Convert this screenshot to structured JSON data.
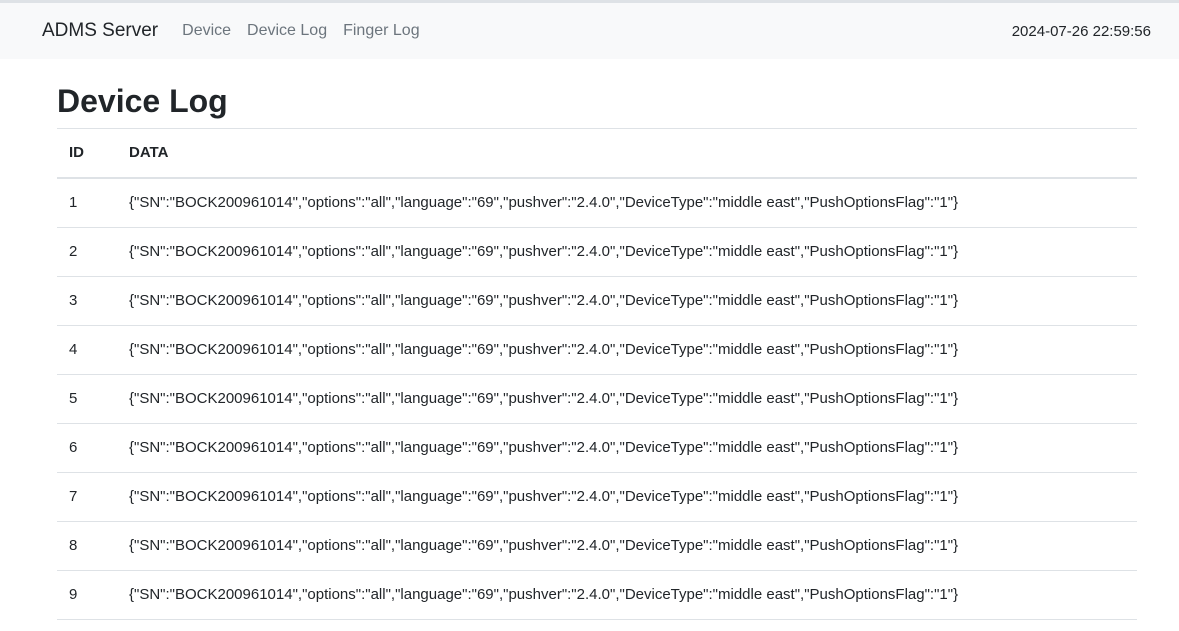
{
  "navbar": {
    "brand": "ADMS Server",
    "links": [
      "Device",
      "Device Log",
      "Finger Log"
    ],
    "clock": "2024-07-26 22:59:56"
  },
  "page": {
    "title": "Device Log"
  },
  "table": {
    "headers": [
      "ID",
      "DATA"
    ],
    "rows": [
      {
        "id": "1",
        "data": "{\"SN\":\"BOCK200961014\",\"options\":\"all\",\"language\":\"69\",\"pushver\":\"2.4.0\",\"DeviceType\":\"middle east\",\"PushOptionsFlag\":\"1\"}"
      },
      {
        "id": "2",
        "data": "{\"SN\":\"BOCK200961014\",\"options\":\"all\",\"language\":\"69\",\"pushver\":\"2.4.0\",\"DeviceType\":\"middle east\",\"PushOptionsFlag\":\"1\"}"
      },
      {
        "id": "3",
        "data": "{\"SN\":\"BOCK200961014\",\"options\":\"all\",\"language\":\"69\",\"pushver\":\"2.4.0\",\"DeviceType\":\"middle east\",\"PushOptionsFlag\":\"1\"}"
      },
      {
        "id": "4",
        "data": "{\"SN\":\"BOCK200961014\",\"options\":\"all\",\"language\":\"69\",\"pushver\":\"2.4.0\",\"DeviceType\":\"middle east\",\"PushOptionsFlag\":\"1\"}"
      },
      {
        "id": "5",
        "data": "{\"SN\":\"BOCK200961014\",\"options\":\"all\",\"language\":\"69\",\"pushver\":\"2.4.0\",\"DeviceType\":\"middle east\",\"PushOptionsFlag\":\"1\"}"
      },
      {
        "id": "6",
        "data": "{\"SN\":\"BOCK200961014\",\"options\":\"all\",\"language\":\"69\",\"pushver\":\"2.4.0\",\"DeviceType\":\"middle east\",\"PushOptionsFlag\":\"1\"}"
      },
      {
        "id": "7",
        "data": "{\"SN\":\"BOCK200961014\",\"options\":\"all\",\"language\":\"69\",\"pushver\":\"2.4.0\",\"DeviceType\":\"middle east\",\"PushOptionsFlag\":\"1\"}"
      },
      {
        "id": "8",
        "data": "{\"SN\":\"BOCK200961014\",\"options\":\"all\",\"language\":\"69\",\"pushver\":\"2.4.0\",\"DeviceType\":\"middle east\",\"PushOptionsFlag\":\"1\"}"
      },
      {
        "id": "9",
        "data": "{\"SN\":\"BOCK200961014\",\"options\":\"all\",\"language\":\"69\",\"pushver\":\"2.4.0\",\"DeviceType\":\"middle east\",\"PushOptionsFlag\":\"1\"}"
      }
    ]
  },
  "colors": {
    "navbar_bg": "#f8f9fa",
    "nav_link": "#6c757d",
    "text": "#212529",
    "border": "#dee2e6"
  }
}
